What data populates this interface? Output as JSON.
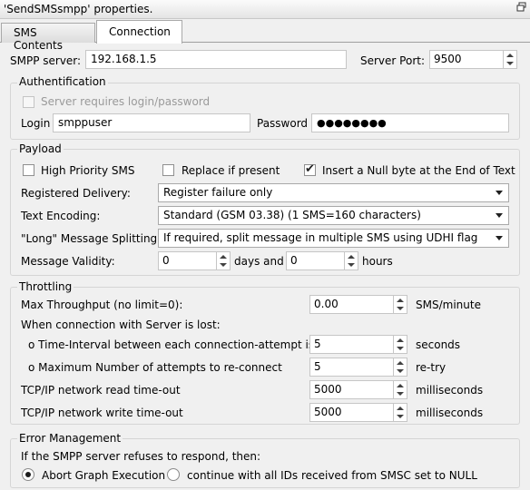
{
  "window": {
    "title": "'SendSMSsmpp' properties."
  },
  "tabs": [
    {
      "label": "SMS Contents",
      "active": false
    },
    {
      "label": "Connection",
      "active": true
    }
  ],
  "server": {
    "smpp_label": "SMPP server:",
    "smpp_value": "192.168.1.5",
    "port_label": "Server Port:",
    "port_value": "9500"
  },
  "authentication": {
    "title": "Authentification",
    "requires_login_label": "Server requires login/password",
    "requires_login_checked": false,
    "login_label": "Login",
    "login_value": "smppuser",
    "password_label": "Password",
    "password_value": "●●●●●●●●"
  },
  "payload": {
    "title": "Payload",
    "high_priority_label": "High Priority SMS",
    "high_priority_checked": false,
    "replace_label": "Replace if present",
    "replace_checked": false,
    "null_byte_label": "Insert a Null byte at the End of Text",
    "null_byte_checked": true,
    "registered_delivery_label": "Registered Delivery:",
    "registered_delivery_value": "Register failure only",
    "text_encoding_label": "Text Encoding:",
    "text_encoding_value": "Standard (GSM 03.38) (1 SMS=160 characters)",
    "splitting_label": "\"Long\" Message Splitting:",
    "splitting_value": "If required, split message in multiple SMS using UDHI flag",
    "validity_label": "Message Validity:",
    "validity_days_value": "0",
    "validity_days_label": "days and",
    "validity_hours_value": "0",
    "validity_hours_label": "hours"
  },
  "throttling": {
    "title": "Throttling",
    "max_throughput_label": "Max Throughput (no limit=0):",
    "max_throughput_value": "0.00",
    "max_throughput_unit": "SMS/minute",
    "connection_lost_label": "When connection with Server is lost:",
    "interval_label": "o Time-Interval between each connection-attempt is:",
    "interval_value": "5",
    "interval_unit": "seconds",
    "max_attempts_label": "o Maximum Number of attempts to re-connect",
    "max_attempts_value": "5",
    "max_attempts_unit": "re-try",
    "read_timeout_label": "TCP/IP network read time-out",
    "read_timeout_value": "5000",
    "read_timeout_unit": "milliseconds",
    "write_timeout_label": "TCP/IP network write time-out",
    "write_timeout_value": "5000",
    "write_timeout_unit": "milliseconds"
  },
  "error_management": {
    "title": "Error Management",
    "description": "If the SMPP server refuses to respond, then:",
    "option_abort_label": "Abort Graph Execution",
    "option_abort_selected": true,
    "option_continue_label": "continue with all IDs received from SMSC set to NULL",
    "option_continue_selected": false
  },
  "icons": {
    "pin": "pin-icon",
    "checkmark": "checkmark-icon"
  }
}
